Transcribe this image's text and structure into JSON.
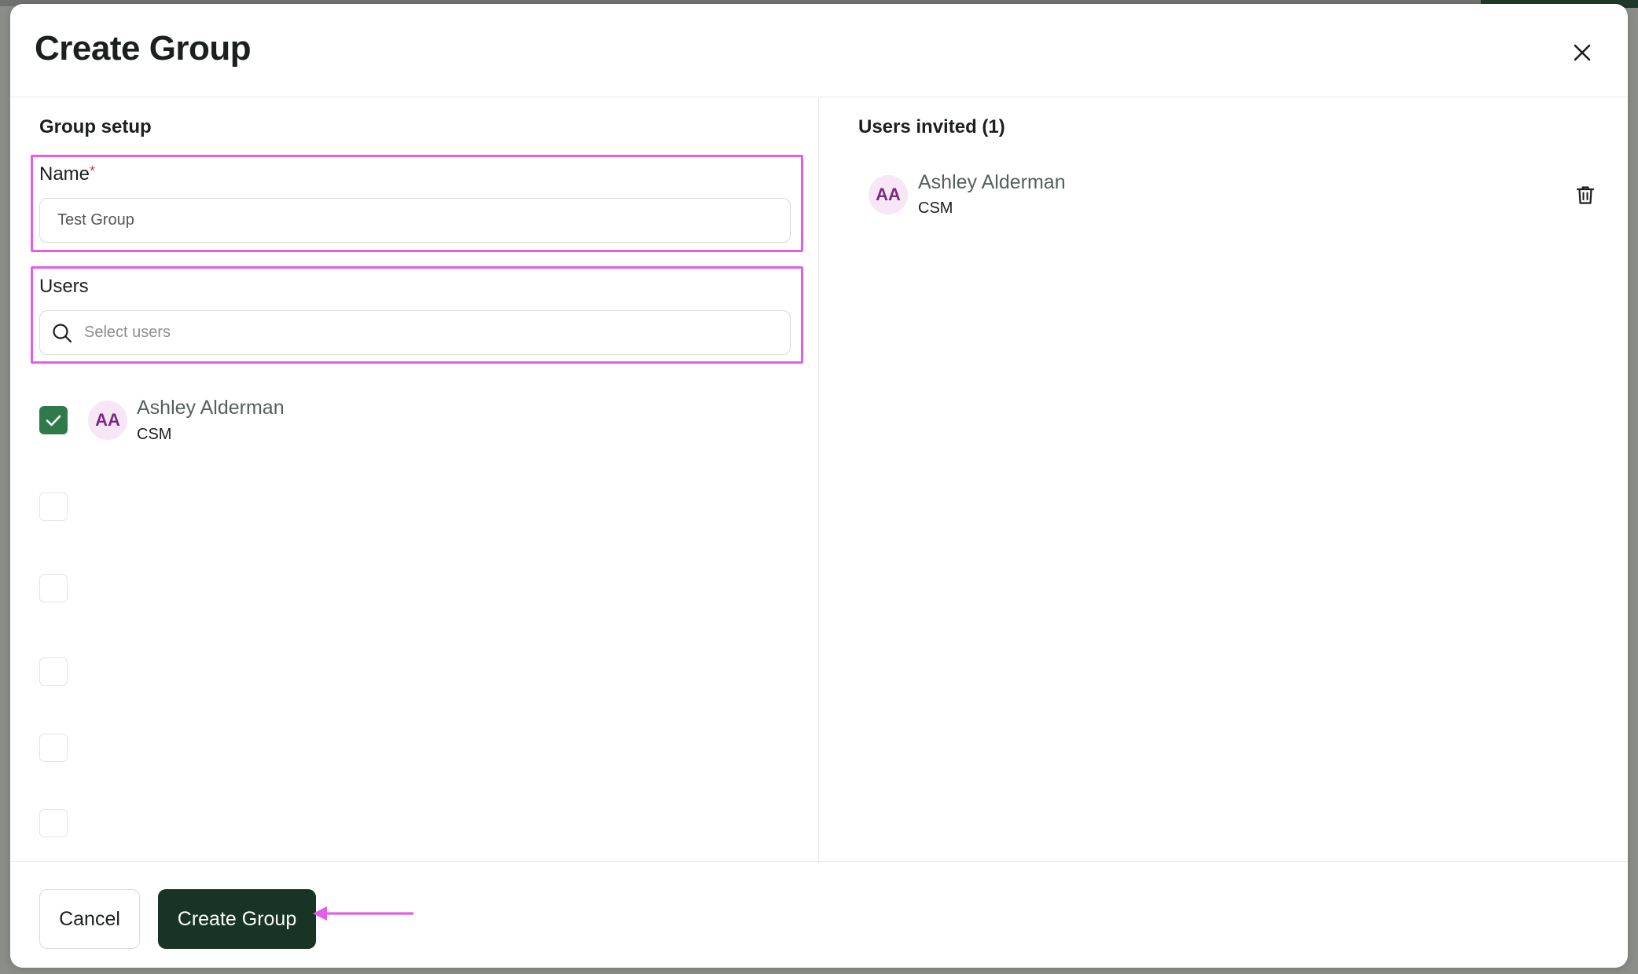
{
  "modal": {
    "title": "Create Group"
  },
  "setup": {
    "section_title": "Group setup",
    "name_label": "Name",
    "name_required_mark": "*",
    "name_value": "Test Group",
    "users_label": "Users",
    "users_placeholder": "Select users"
  },
  "user_list": [
    {
      "initials": "AA",
      "name": "Ashley Alderman",
      "role": "CSM",
      "checked": true
    }
  ],
  "empty_rows": 6,
  "invited": {
    "title": "Users invited (1)",
    "users": [
      {
        "initials": "AA",
        "name": "Ashley Alderman",
        "role": "CSM"
      }
    ]
  },
  "footer": {
    "cancel_label": "Cancel",
    "create_label": "Create Group"
  },
  "colors": {
    "primary": "#183424",
    "checkbox_checked": "#2f7a4b",
    "highlight": "#e35de8",
    "avatar_bg": "#f6e6f6",
    "avatar_text": "#7a2a7e",
    "required": "#d23b3b"
  },
  "icons": {
    "close": "close-icon",
    "search": "search-icon",
    "check": "check-icon",
    "trash": "trash-icon",
    "arrow": "arrow-left-icon"
  }
}
